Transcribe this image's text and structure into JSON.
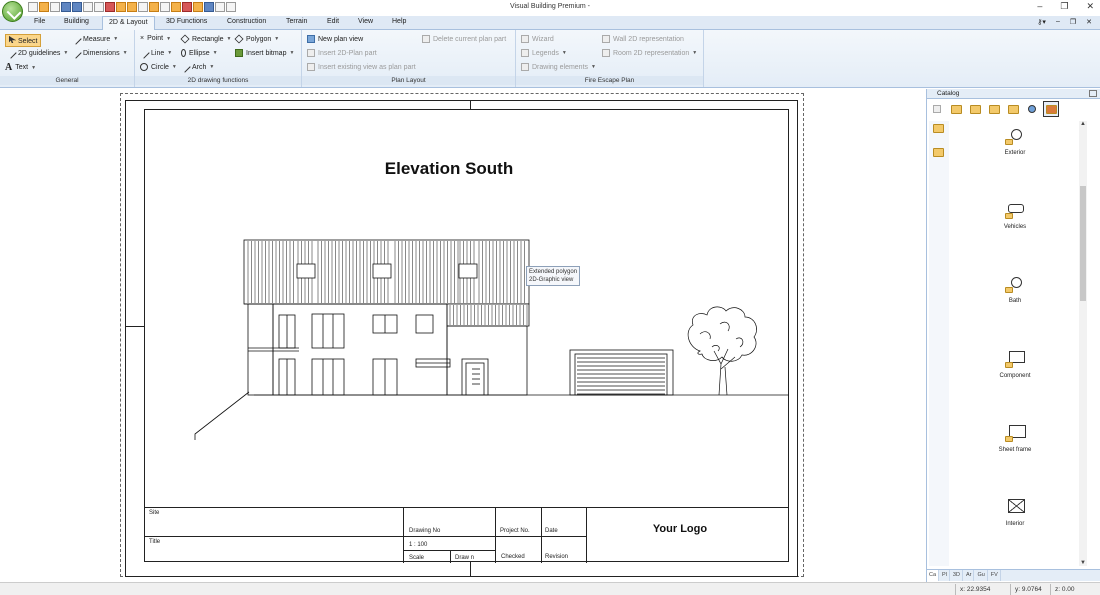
{
  "window": {
    "title": "Visual Building Premium -"
  },
  "tabs": [
    "File",
    "Building",
    "2D & Layout",
    "3D Functions",
    "Construction",
    "Terrain",
    "Edit",
    "View",
    "Help"
  ],
  "active_tab": "2D & Layout",
  "ribbon": {
    "general": {
      "label": "General",
      "select": "Select",
      "measure": "Measure",
      "guidelines": "2D guidelines",
      "dimensions": "Dimensions",
      "text": "Text"
    },
    "drawing": {
      "label": "2D drawing functions",
      "point": "Point",
      "rectangle": "Rectangle",
      "polygon": "Polygon",
      "line": "Line",
      "ellipse": "Ellipse",
      "insert_bitmap": "Insert bitmap",
      "circle": "Circle",
      "arch": "Arch"
    },
    "layout": {
      "label": "Plan Layout",
      "new_plan_view": "New plan view",
      "delete_plan_part": "Delete current plan part",
      "insert_2d_plan_part": "Insert 2D-Plan part",
      "insert_existing_view": "Insert existing view as plan part"
    },
    "fire": {
      "label": "Fire Escape Plan",
      "wizard": "Wizard",
      "wall_2d": "Wall 2D representation",
      "legends": "Legends",
      "room_2d": "Room 2D representation",
      "drawing_elements": "Drawing elements"
    }
  },
  "drawing": {
    "title": "Elevation South",
    "tooltip_line1": "Extended polygon",
    "tooltip_line2": "2D-Graphic view"
  },
  "titleblock": {
    "site": "Site",
    "title": "Title",
    "drawing_no": "Drawing No",
    "scale_value": "1 : 100",
    "scale": "Scale",
    "drawn": "Draw n",
    "project_no": "Project No.",
    "checked": "Checked",
    "date": "Date",
    "revision": "Revision",
    "logo": "Your Logo"
  },
  "catalog": {
    "title": "Catalog",
    "items": [
      "Exterior",
      "Vehicles",
      "Bath",
      "Component",
      "Sheet frame",
      "Interior"
    ],
    "bottom_tabs": [
      "Ca",
      "Pl",
      "3D",
      "Ar",
      "Gu",
      "FV"
    ]
  },
  "status": {
    "x": "x: 22.9354",
    "y": "y: 9.0764",
    "z": "z: 0.00"
  }
}
